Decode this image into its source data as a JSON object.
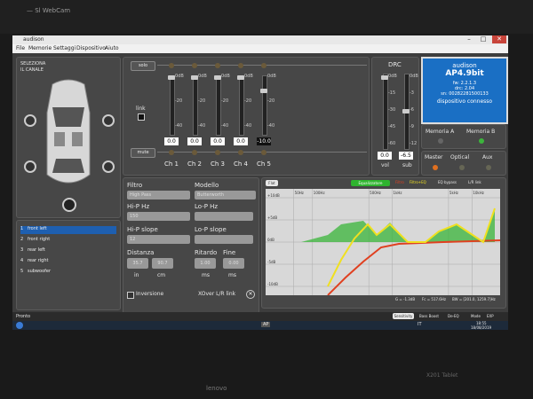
{
  "bezel": {
    "label": "— Sl WebCam"
  },
  "window": {
    "title": "audison",
    "min": "–",
    "max": "□",
    "close": "✕"
  },
  "menu": [
    "File",
    "Memorie",
    "Settaggi",
    "Dispositivo",
    "Aiuto"
  ],
  "left_panel": {
    "title_line1": "SELEZIONA",
    "title_line2": "IL CANALE"
  },
  "channels": [
    {
      "num": "1",
      "name": "front left",
      "hz": ""
    },
    {
      "num": "2",
      "name": "front right",
      "hz": ""
    },
    {
      "num": "3",
      "name": "rear left",
      "hz": ""
    },
    {
      "num": "4",
      "name": "rear right",
      "hz": ""
    },
    {
      "num": "5",
      "name": "subwoofer",
      "hz": ""
    }
  ],
  "mixer": {
    "solo": "solo",
    "mute": "mute",
    "link": "link",
    "odb": "0dB",
    "ticks": [
      "-20",
      "-40"
    ],
    "strips": [
      {
        "label": "Ch 1",
        "value": "0.0"
      },
      {
        "label": "Ch 2",
        "value": "0.0"
      },
      {
        "label": "Ch 3",
        "value": "0.0"
      },
      {
        "label": "Ch 4",
        "value": "0.0"
      },
      {
        "label": "Ch 5",
        "value": "-10.0",
        "level": 0.25
      }
    ]
  },
  "drc": {
    "title": "DRC",
    "vol_ticks": [
      "0dB",
      "-15",
      "-30",
      "-45",
      "-60"
    ],
    "sub_ticks": [
      "0dB",
      "-3",
      "-6",
      "-9",
      "-12"
    ],
    "vol_value": "0.0",
    "sub_value": "-6.5",
    "vol_label": "vol",
    "sub_label": "sub"
  },
  "device": {
    "brand": "audison",
    "model": "AP4.9bit",
    "fw": "fw: 2.2.1.3",
    "drc": "drc: 2.04",
    "sn": "sn: 00282281500133",
    "status": "dispositivo connesso"
  },
  "memory": {
    "a": "Memoria A",
    "b": "Memoria B"
  },
  "inputs": {
    "master": "Master",
    "optical": "Optical",
    "aux": "Aux"
  },
  "filter": {
    "filtro_label": "Filtro",
    "filtro_value": "High Pass",
    "modello_label": "Modello",
    "modello_value": "Butterworth",
    "hip_hz_label": "Hi-P Hz",
    "hip_hz_value": "150",
    "lop_hz_label": "Lo-P Hz",
    "hip_slope_label": "Hi-P slope",
    "hip_slope_value": "12",
    "lop_slope_label": "Lo-P slope",
    "distanza_label": "Distanza",
    "dist_in": "35.7",
    "dist_cm": "90.7",
    "in": "in",
    "cm": "cm",
    "ritardo_label": "Ritardo",
    "ritardo_value": "1.00",
    "ms": "ms",
    "fine_label": "Fine",
    "fine_value": "0.00",
    "fine_ms": "ms",
    "inversione": "Inversione",
    "xover_link": "XOver L/R link"
  },
  "eq": {
    "flat": "Flat",
    "equalizzatore": "Equalizzatore",
    "filtro": "Filtro",
    "filtro_eq": "Filtro+EQ",
    "eq_bypass": "EQ bypass",
    "lr_link": "L/R link",
    "y_labels": [
      "+10dB",
      "+5dB",
      "0dB",
      "-5dB",
      "-10dB"
    ],
    "x_labels": [
      "50Hz",
      "100Hz",
      "500Hz",
      "1kHz",
      "5kHz",
      "10kHz"
    ],
    "readout_g": "G = -1.3dB",
    "readout_fc": "Fc = 517.6Hz",
    "readout_bw": "BW = [201.0, 1259.7]Hz",
    "colors": {
      "green": "#2fb42f",
      "yellow": "#f0e020",
      "red": "#e04020"
    }
  },
  "status": {
    "left": "Pronto",
    "sensitivity": "Sensitivity",
    "bass_boost": "Bass Boost",
    "de_eq": "De-EQ",
    "mode": "Mode",
    "exp": "EXP"
  },
  "taskbar": {
    "lang": "IT",
    "time": "18:55",
    "date": "18/08/2019",
    "ap": "AP"
  },
  "laptop": {
    "brand": "lenovo",
    "model": "X201 Tablet"
  }
}
